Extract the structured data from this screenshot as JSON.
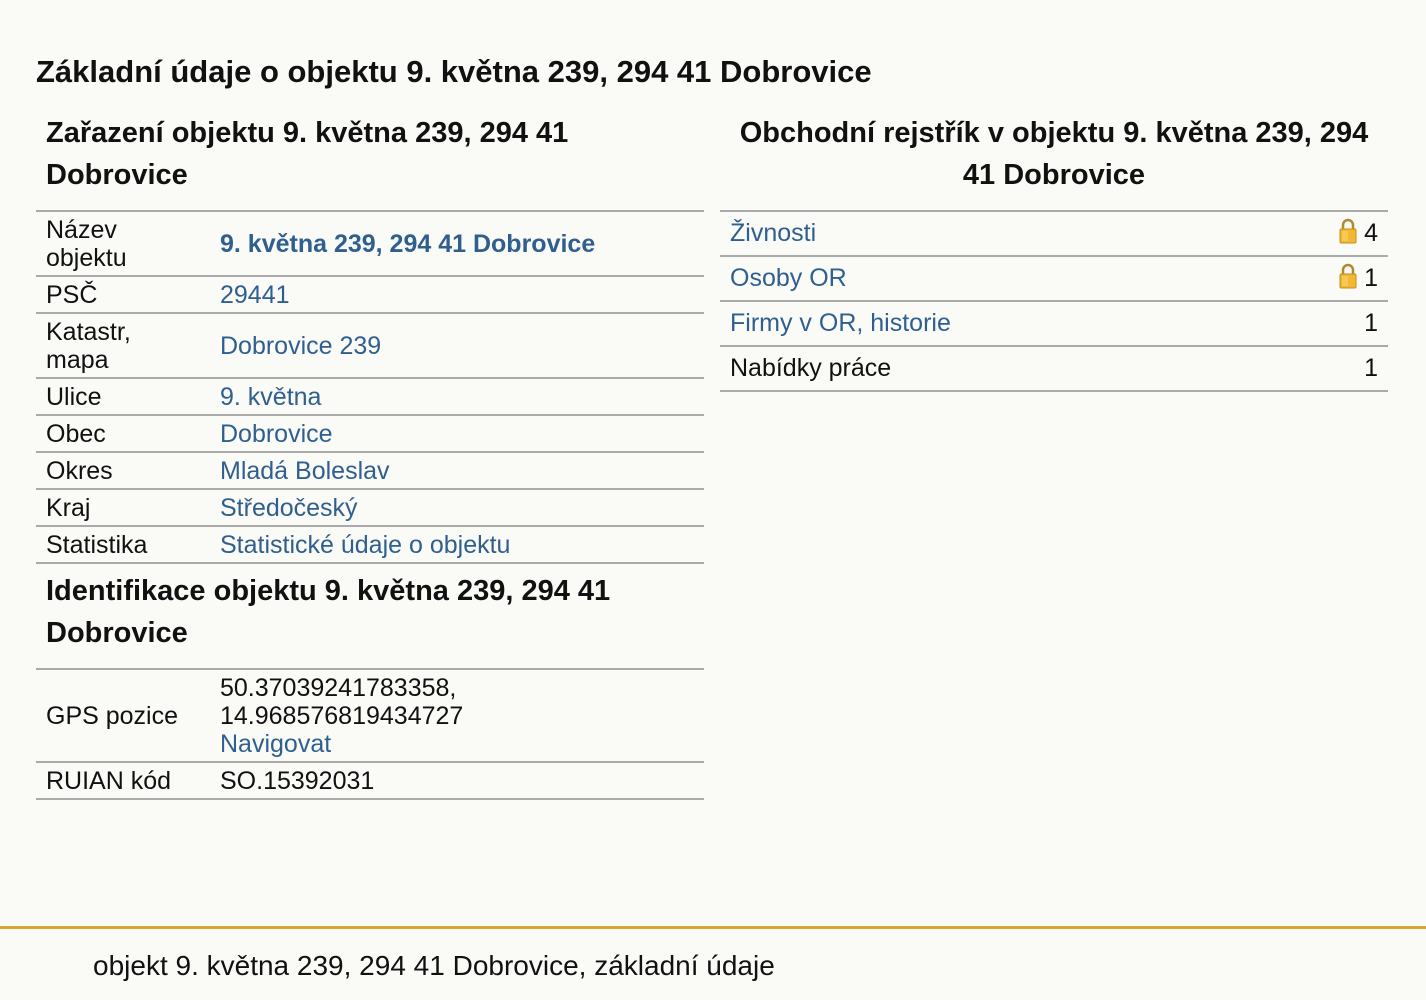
{
  "page_title": "Základní údaje o objektu 9. května 239, 294 41 Dobrovice",
  "zarazeni": {
    "heading": "Zařazení objektu 9. května 239, 294 41 Dobrovice",
    "rows": [
      {
        "label": "Název objektu",
        "value": "9. května 239, 294 41 Dobrovice"
      },
      {
        "label": "PSČ",
        "value": "29441"
      },
      {
        "label": "Katastr, mapa",
        "value": "Dobrovice 239"
      },
      {
        "label": "Ulice",
        "value": "9. května"
      },
      {
        "label": "Obec",
        "value": "Dobrovice"
      },
      {
        "label": "Okres",
        "value": "Mladá Boleslav"
      },
      {
        "label": "Kraj",
        "value": "Středočeský"
      },
      {
        "label": "Statistika",
        "value": "Statistické údaje o objektu"
      }
    ]
  },
  "identifikace": {
    "heading": "Identifikace objektu 9. května 239, 294 41 Dobrovice",
    "gps_label": "GPS pozice",
    "gps_value_line1": "50.37039241783358,",
    "gps_value_line2": "14.968576819434727",
    "gps_link": "Navigovat",
    "ruian_label": "RUIAN kód",
    "ruian_value": "SO.15392031"
  },
  "rejstrik": {
    "heading": "Obchodní rejstřík v objektu 9. května 239, 294 41 Dobrovice",
    "rows": [
      {
        "label": "Živnosti",
        "count": "4",
        "locked": true,
        "icon": "lock-icon"
      },
      {
        "label": "Osoby OR",
        "count": "1",
        "locked": true,
        "icon": "lock-icon"
      },
      {
        "label": "Firmy v OR, historie",
        "count": "1",
        "locked": false
      },
      {
        "label": "Nabídky práce",
        "count": "1",
        "locked": false
      }
    ]
  },
  "footer": {
    "text": "objekt 9. května 239, 294 41 Dobrovice, základní údaje"
  },
  "colors": {
    "link": "#2f5f8f",
    "footer_line": "#d9a62e",
    "background": "#fafaf7"
  }
}
